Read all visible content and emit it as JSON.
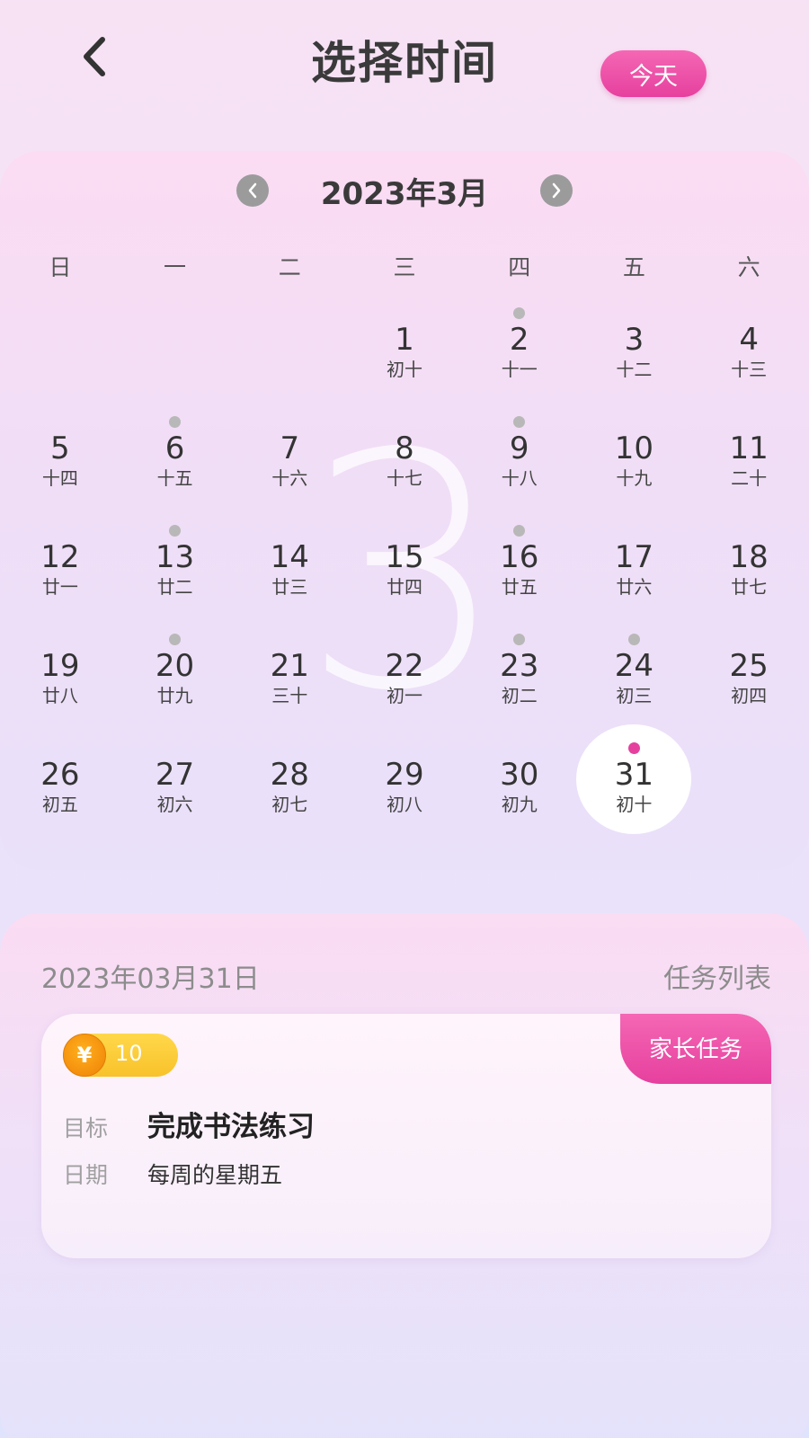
{
  "header": {
    "title": "选择时间",
    "today_label": "今天",
    "back_icon": "chevron-left-icon"
  },
  "calendar": {
    "month_title": "2023年3月",
    "watermark": "3",
    "prev_icon": "chevron-left-icon",
    "next_icon": "chevron-right-icon",
    "weekdays": [
      "日",
      "一",
      "二",
      "三",
      "四",
      "五",
      "六"
    ],
    "leading_blanks": 3,
    "days": [
      {
        "solar": "1",
        "lunar": "初十",
        "dot": false
      },
      {
        "solar": "2",
        "lunar": "十一",
        "dot": true
      },
      {
        "solar": "3",
        "lunar": "十二",
        "dot": false
      },
      {
        "solar": "4",
        "lunar": "十三",
        "dot": false
      },
      {
        "solar": "5",
        "lunar": "十四",
        "dot": false
      },
      {
        "solar": "6",
        "lunar": "十五",
        "dot": true
      },
      {
        "solar": "7",
        "lunar": "十六",
        "dot": false
      },
      {
        "solar": "8",
        "lunar": "十七",
        "dot": false
      },
      {
        "solar": "9",
        "lunar": "十八",
        "dot": true
      },
      {
        "solar": "10",
        "lunar": "十九",
        "dot": false
      },
      {
        "solar": "11",
        "lunar": "二十",
        "dot": false
      },
      {
        "solar": "12",
        "lunar": "廿一",
        "dot": false
      },
      {
        "solar": "13",
        "lunar": "廿二",
        "dot": true
      },
      {
        "solar": "14",
        "lunar": "廿三",
        "dot": false
      },
      {
        "solar": "15",
        "lunar": "廿四",
        "dot": false
      },
      {
        "solar": "16",
        "lunar": "廿五",
        "dot": true
      },
      {
        "solar": "17",
        "lunar": "廿六",
        "dot": false
      },
      {
        "solar": "18",
        "lunar": "廿七",
        "dot": false
      },
      {
        "solar": "19",
        "lunar": "廿八",
        "dot": false
      },
      {
        "solar": "20",
        "lunar": "廿九",
        "dot": true
      },
      {
        "solar": "21",
        "lunar": "三十",
        "dot": false
      },
      {
        "solar": "22",
        "lunar": "初一",
        "dot": false
      },
      {
        "solar": "23",
        "lunar": "初二",
        "dot": true
      },
      {
        "solar": "24",
        "lunar": "初三",
        "dot": true
      },
      {
        "solar": "25",
        "lunar": "初四",
        "dot": false
      },
      {
        "solar": "26",
        "lunar": "初五",
        "dot": false
      },
      {
        "solar": "27",
        "lunar": "初六",
        "dot": false
      },
      {
        "solar": "28",
        "lunar": "初七",
        "dot": false
      },
      {
        "solar": "29",
        "lunar": "初八",
        "dot": false
      },
      {
        "solar": "30",
        "lunar": "初九",
        "dot": false
      },
      {
        "solar": "31",
        "lunar": "初十",
        "dot": true,
        "selected": true
      }
    ],
    "colors": {
      "dot": "#b8b8b8",
      "selected_dot": "#e6409e",
      "selected_bg": "#ffffff"
    }
  },
  "task_panel": {
    "date": "2023年03月31日",
    "label": "任务列表",
    "card": {
      "coin_symbol": "¥",
      "coin_value": "10",
      "tag": "家长任务",
      "goal_key": "目标",
      "goal_value": "完成书法练习",
      "date_key": "日期",
      "date_value": "每周的星期五"
    }
  },
  "accent": "#e6409e"
}
